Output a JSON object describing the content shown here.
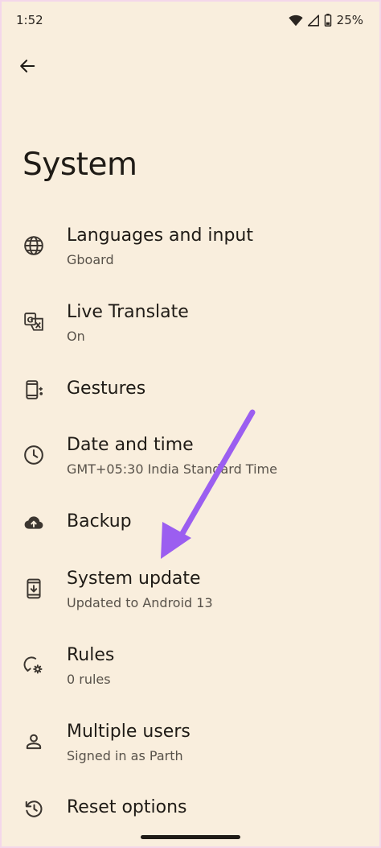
{
  "status_bar": {
    "time": "1:52",
    "battery": "25%",
    "icons": [
      "wifi-icon",
      "signal-icon",
      "battery-icon"
    ]
  },
  "header": {
    "back_icon": "arrow-back-icon",
    "title": "System"
  },
  "items": [
    {
      "title": "Languages and input",
      "subtitle": "Gboard",
      "icon": "globe-icon"
    },
    {
      "title": "Live Translate",
      "subtitle": "On",
      "icon": "translate-icon"
    },
    {
      "title": "Gestures",
      "subtitle": "",
      "icon": "gestures-phone-icon"
    },
    {
      "title": "Date and time",
      "subtitle": "GMT+05:30 India Standard Time",
      "icon": "clock-icon"
    },
    {
      "title": "Backup",
      "subtitle": "",
      "icon": "cloud-upload-icon"
    },
    {
      "title": "System update",
      "subtitle": "Updated to Android 13",
      "icon": "system-update-icon"
    },
    {
      "title": "Rules",
      "subtitle": "0 rules",
      "icon": "rules-icon"
    },
    {
      "title": "Multiple users",
      "subtitle": "Signed in as Parth",
      "icon": "person-icon"
    },
    {
      "title": "Reset options",
      "subtitle": "",
      "icon": "reset-icon"
    }
  ],
  "colors": {
    "background": "#f9eedd",
    "text_primary": "#1f1b16",
    "text_secondary": "#58524a",
    "annotation_arrow": "#9b5ef0"
  }
}
